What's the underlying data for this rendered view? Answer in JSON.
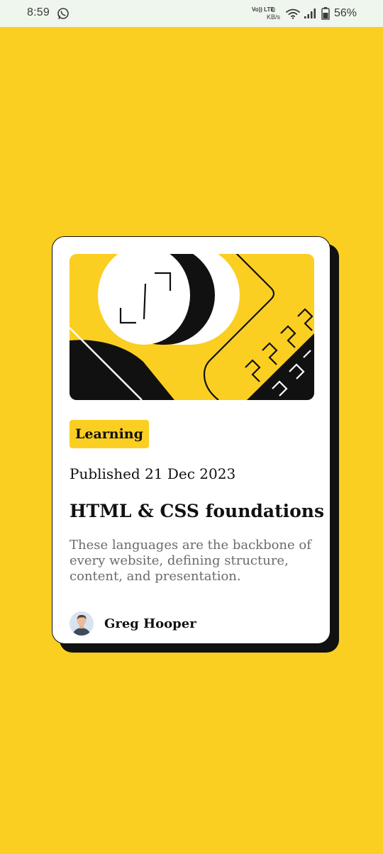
{
  "status_bar": {
    "time": "8:59",
    "network_type": "Vo)) LTE",
    "data_speed_value": "0",
    "data_speed_unit": "KB/s",
    "battery_percent": "56%",
    "icons": [
      "whatsapp-icon",
      "wifi-icon",
      "signal-icon",
      "battery-icon"
    ]
  },
  "card": {
    "category_tag": "Learning",
    "published": "Published 21 Dec 2023",
    "title": "HTML & CSS foundations",
    "excerpt": "These languages are the backbone of every website, defining structure, content, and presentation.",
    "author_name": "Greg Hooper"
  },
  "colors": {
    "background": "#FBCE22",
    "accent_yellow": "#FBCE22",
    "card_background": "#FFFFFF",
    "ink": "#111111",
    "excerpt_text": "#6B6B6B",
    "status_bar_background": "#EFF6EE"
  }
}
